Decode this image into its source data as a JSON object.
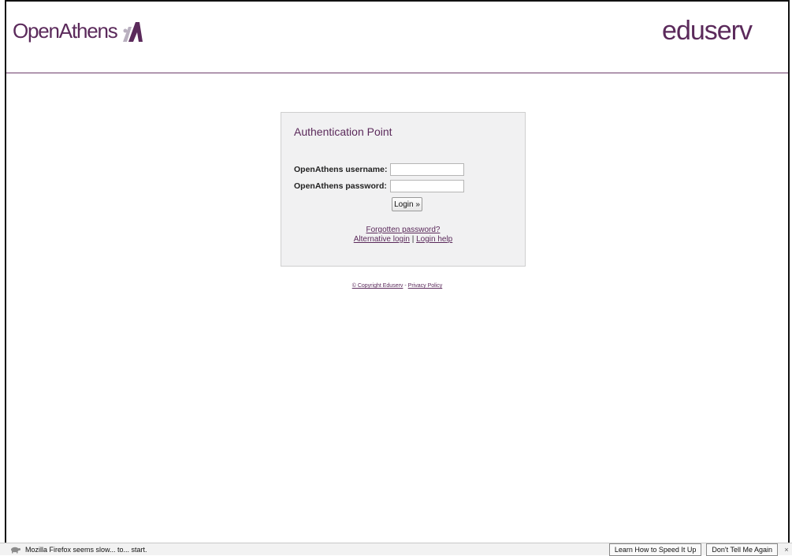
{
  "header": {
    "left_logo_text": "OpenAthens",
    "right_logo_text": "eduserv",
    "brand_color": "#5b2a5b"
  },
  "auth_panel": {
    "title": "Authentication Point",
    "username_label": "OpenAthens username:",
    "password_label": "OpenAthens password:",
    "username_value": "",
    "password_value": "",
    "login_button": "Login »",
    "links": {
      "forgotten": "Forgotten password?",
      "alternative": "Alternative login",
      "separator": "|",
      "help": "Login help"
    }
  },
  "footer": {
    "copyright": "© Copyright Eduserv",
    "dash": "-",
    "privacy": "Privacy Policy"
  },
  "statusbar": {
    "message": "Mozilla Firefox seems slow... to... start.",
    "learn_button": "Learn How to Speed It Up",
    "dont_tell_button": "Don't Tell Me Again",
    "close_symbol": "×",
    "icon": "turtle-icon"
  }
}
